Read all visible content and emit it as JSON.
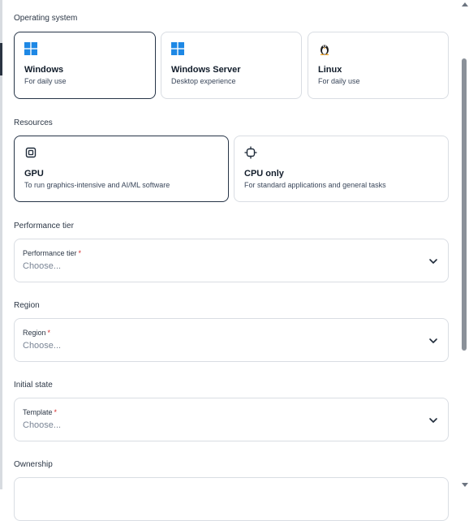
{
  "os": {
    "label": "Operating system",
    "options": [
      {
        "title": "Windows",
        "subtitle": "For daily use",
        "icon": "windows-icon",
        "selected": true
      },
      {
        "title": "Windows Server",
        "subtitle": "Desktop experience",
        "icon": "windows-icon",
        "selected": false
      },
      {
        "title": "Linux",
        "subtitle": "For daily use",
        "icon": "linux-penguin-icon",
        "selected": false
      }
    ]
  },
  "resources": {
    "label": "Resources",
    "options": [
      {
        "title": "GPU",
        "subtitle": "To run graphics-intensive and AI/ML software",
        "icon": "gpu-chip-icon",
        "selected": true
      },
      {
        "title": "CPU only",
        "subtitle": "For standard applications and general tasks",
        "icon": "cpu-chip-icon",
        "selected": false
      }
    ]
  },
  "performance": {
    "label": "Performance tier",
    "field_label": "Performance tier",
    "required": "*",
    "placeholder": "Choose..."
  },
  "region": {
    "label": "Region",
    "field_label": "Region",
    "required": "*",
    "placeholder": "Choose..."
  },
  "initial_state": {
    "label": "Initial state",
    "field_label": "Template",
    "required": "*",
    "placeholder": "Choose..."
  },
  "ownership": {
    "label": "Ownership"
  },
  "colors": {
    "windows_blue": "#1e88e5",
    "selected_border": "#263447",
    "required": "#d32f2f"
  }
}
